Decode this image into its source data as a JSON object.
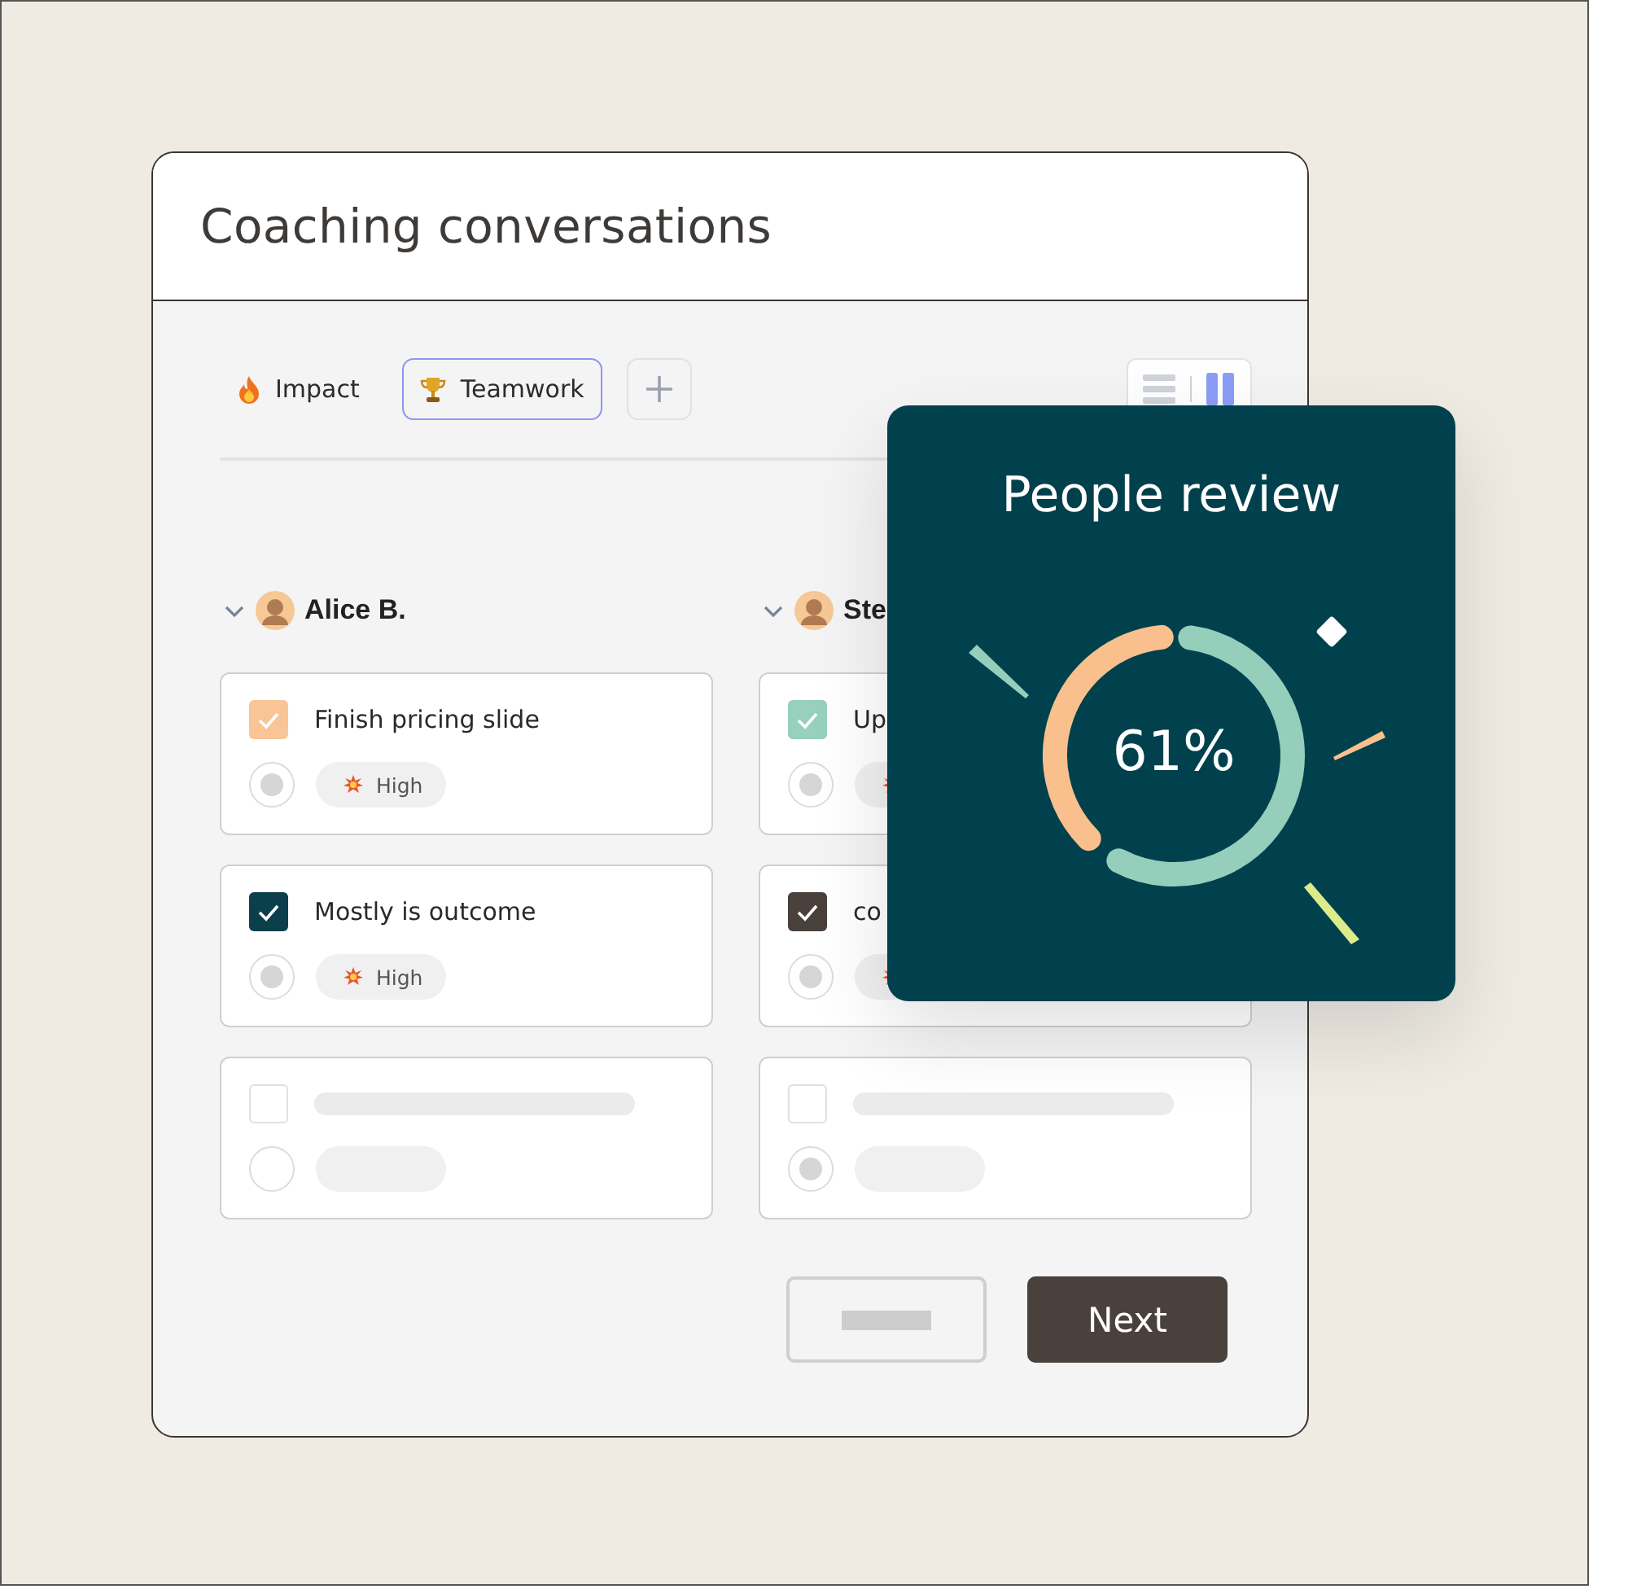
{
  "window": {
    "title": "Coaching conversations"
  },
  "tags": [
    {
      "label": "Impact",
      "selected": false
    },
    {
      "label": "Teamwork",
      "selected": true
    }
  ],
  "view_toggle": [
    {
      "selected": false
    },
    {
      "selected": true
    }
  ],
  "columns": [
    {
      "name": "Alice B.",
      "expanded": true,
      "tasks": [
        {
          "kind": "task",
          "title": "Finish pricing slide",
          "checked": true,
          "color": "#f9c597",
          "priority": "High",
          "on": true
        },
        {
          "kind": "task",
          "title": "Mostly is outcome",
          "checked": true,
          "color": "#0c3f4c",
          "priority": "High",
          "on": true
        },
        {
          "kind": "placeholder",
          "checked": false,
          "on": false
        }
      ]
    },
    {
      "name": "Ste",
      "expanded": true,
      "tasks": [
        {
          "kind": "task",
          "title": "Up",
          "checked": true,
          "color": "#97d0bd",
          "on": true
        },
        {
          "kind": "task",
          "title": "co",
          "checked": true,
          "color": "#4a403c",
          "on": true
        },
        {
          "kind": "placeholder",
          "checked": false,
          "on": true
        }
      ]
    }
  ],
  "buttons": [
    {
      "kind": "blank"
    },
    {
      "kind": "primary",
      "label": "Next"
    }
  ],
  "review": {
    "title": "People review",
    "level": 0.61,
    "reading": "61%"
  }
}
